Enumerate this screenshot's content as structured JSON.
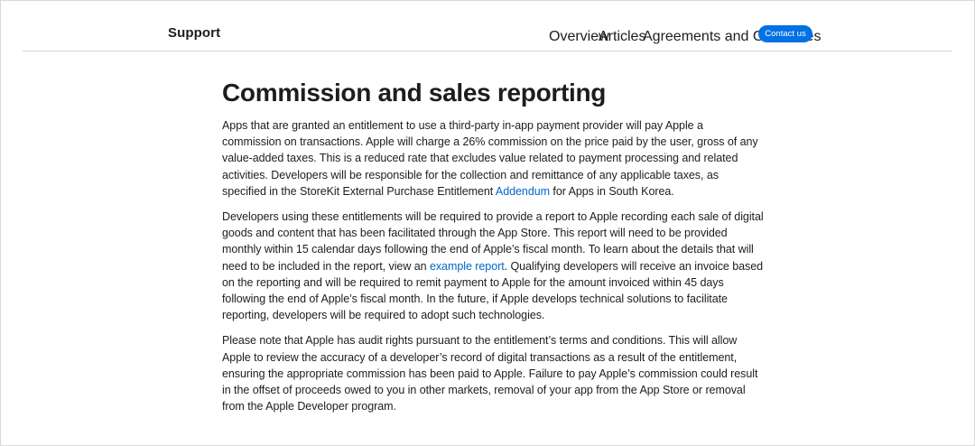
{
  "nav": {
    "brand": "Support",
    "links": [
      "Overview",
      "Articles",
      "Agreements and Guidelines"
    ],
    "contact_label": "Contact us"
  },
  "article": {
    "title": "Commission and sales reporting",
    "p1_text_a": "Apps that are granted an entitlement to use a third-party in-app payment provider will pay Apple a commission on transactions. Apple will charge a 26% commission on the price paid by the user, gross of any value-added taxes. This is a reduced rate that excludes value related to payment processing and related activities. Developers will be responsible for the collection and remittance of any applicable taxes, as specified in the StoreKit External Purchase Entitlement ",
    "p1_link": "Addendum",
    "p1_text_b": " for Apps in South Korea.",
    "p2_text_a": "Developers using these entitlements will be required to provide a report to Apple recording each sale of digital goods and content that has been facilitated through the App Store. This report will need to be provided monthly within 15 calendar days following the end of Apple’s fiscal month. To learn about the details that will need to be included in the report, view an ",
    "p2_link": "example report",
    "p2_text_b": ". Qualifying developers will receive an invoice based on the reporting and will be required to remit payment to Apple for the amount invoiced within 45 days following the end of Apple’s fiscal month. In the future, if Apple develops technical solutions to facilitate reporting, developers will be required to adopt such technologies.",
    "p3_text": "Please note that Apple has audit rights pursuant to the entitlement’s terms and conditions. This will allow Apple to review the accuracy of a developer’s record of digital transactions as a result of the entitlement, ensuring the appropriate commission has been paid to Apple. Failure to pay Apple’s commission could result in the offset of proceeds owed to you in other markets, removal of your app from the App Store or removal from the Apple Developer program."
  },
  "colors": {
    "accent": "#0071e3",
    "link": "#0066cc",
    "text": "#1d1d1f"
  }
}
